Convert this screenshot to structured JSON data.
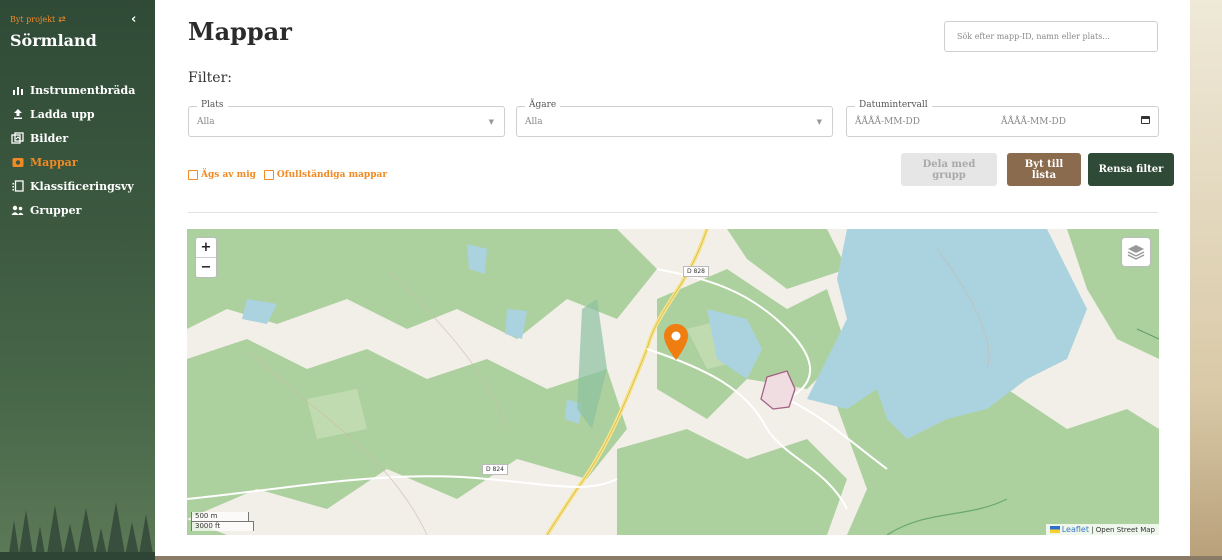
{
  "sidebar": {
    "switch_label": "Byt projekt",
    "project_name": "Sörmland",
    "items": [
      {
        "label": "Instrumentbräda",
        "icon": "bar-chart-icon"
      },
      {
        "label": "Ladda upp",
        "icon": "upload-icon"
      },
      {
        "label": "Bilder",
        "icon": "image-icon"
      },
      {
        "label": "Mappar",
        "icon": "camera-icon",
        "active": true
      },
      {
        "label": "Klassificeringsvy",
        "icon": "classify-icon"
      },
      {
        "label": "Grupper",
        "icon": "group-icon"
      }
    ]
  },
  "header": {
    "title": "Mappar",
    "search_placeholder": "Sök efter mapp-ID, namn eller plats..."
  },
  "filter": {
    "label": "Filter:",
    "place": {
      "legend": "Plats",
      "value": "Alla"
    },
    "owner": {
      "legend": "Ägare",
      "value": "Alla"
    },
    "date": {
      "legend": "Datumintervall",
      "from_placeholder": "ÅÅÅÅ-MM-DD",
      "to_placeholder": "ÅÅÅÅ-MM-DD"
    },
    "checkboxes": [
      "Ägs av mig",
      "Ofullständiga mappar"
    ]
  },
  "buttons": {
    "share": "Dela med grupp",
    "switch_list": "Byt till lista",
    "clear": "Rensa filter"
  },
  "map": {
    "zoom_in": "+",
    "zoom_out": "−",
    "scale_m": "500 m",
    "scale_ft": "3000 ft",
    "road_labels": [
      "D 828",
      "D 824"
    ],
    "attribution_leaflet": "Leaflet",
    "attribution_osm": "| Open Street Map"
  },
  "colors": {
    "sidebar_bg": "#2f4a36",
    "accent": "#f08a24",
    "brown_button": "#8b6b4e",
    "dark_button": "#2f4a36",
    "forest": "#add19e",
    "water": "#aad3df"
  }
}
